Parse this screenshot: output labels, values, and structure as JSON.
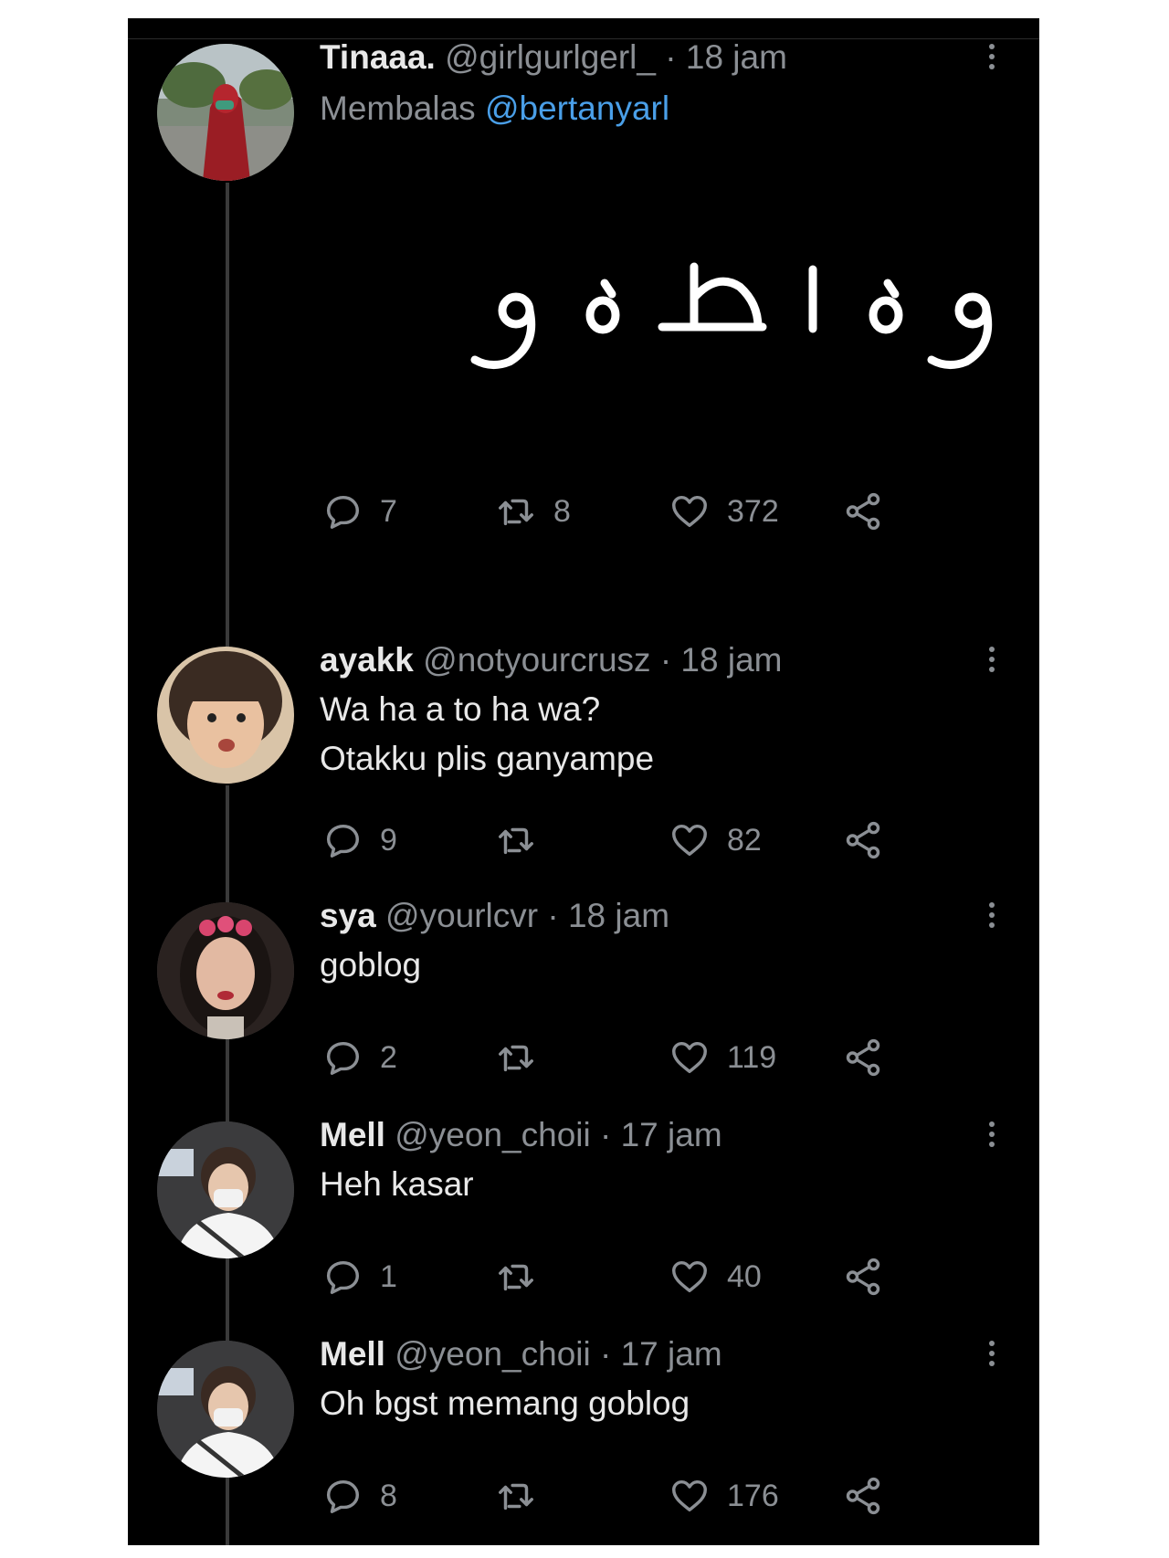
{
  "tweets": [
    {
      "name": "Tinaaa.",
      "handle": "@girlgurlgerl_",
      "time": "· 18 jam",
      "reply_prefix": "Membalas",
      "reply_mention": "@bertanyarl",
      "reply_count": "7",
      "retweet_count": "8",
      "like_count": "372"
    },
    {
      "name": "ayakk",
      "handle": "@notyourcrusz",
      "time": "· 18 jam",
      "text_line1": "Wa ha a to ha wa?",
      "text_line2": "Otakku plis ganyampe",
      "reply_count": "9",
      "retweet_count": "",
      "like_count": "82"
    },
    {
      "name": "sya",
      "handle": "@yourlcvr",
      "time": "· 18 jam",
      "text_line1": "goblog",
      "reply_count": "2",
      "retweet_count": "",
      "like_count": "119"
    },
    {
      "name": "Mell",
      "handle": "@yeon_choii",
      "time": "· 17 jam",
      "text_line1": "Heh kasar",
      "reply_count": "1",
      "retweet_count": "",
      "like_count": "40"
    },
    {
      "name": "Mell",
      "handle": "@yeon_choii",
      "time": "· 17 jam",
      "text_line1": "Oh bgst memang goblog",
      "reply_count": "8",
      "retweet_count": "",
      "like_count": "176"
    }
  ],
  "colors": {
    "background": "#000000",
    "text_primary": "#e8e8e8",
    "text_secondary": "#8b8f94",
    "mention": "#4a9fe8"
  },
  "icons": [
    "reply-icon",
    "retweet-icon",
    "like-icon",
    "share-icon",
    "more-icon"
  ]
}
